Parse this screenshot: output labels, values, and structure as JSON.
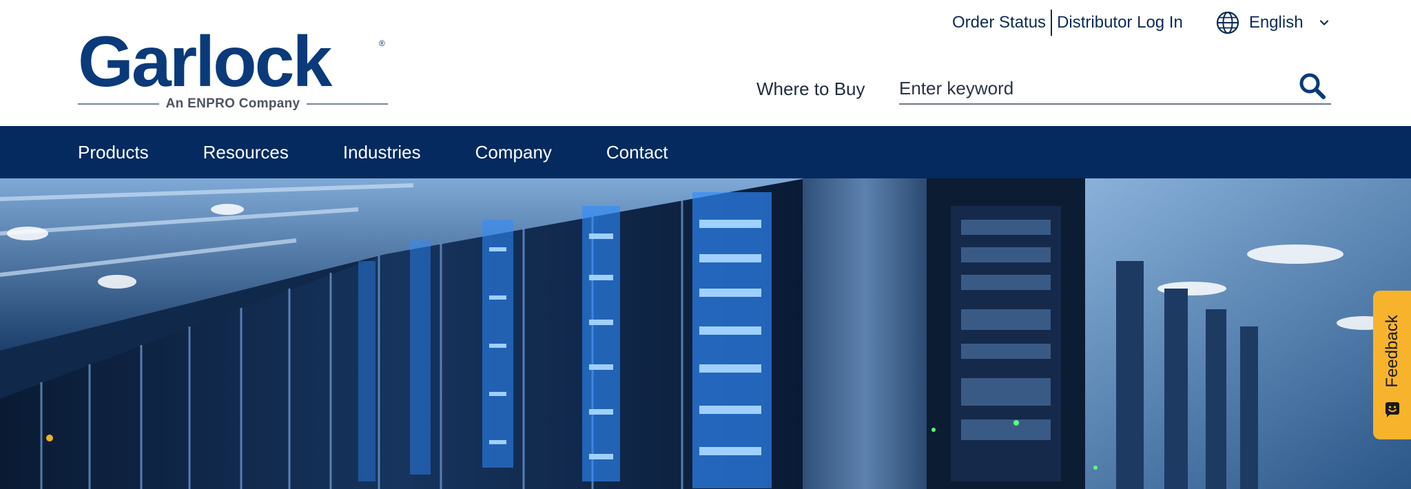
{
  "brand": {
    "name": "Garlock",
    "tagline": "An ENPRO Company",
    "primary_color": "#042a5f",
    "logo_color": "#0a3a7a"
  },
  "utility": {
    "order_status": "Order Status",
    "distributor_login": "Distributor Log In",
    "language": "English"
  },
  "header": {
    "where_to_buy": "Where to Buy",
    "search_placeholder": "Enter keyword",
    "search_value": ""
  },
  "nav": {
    "items": [
      {
        "label": "Products"
      },
      {
        "label": "Resources"
      },
      {
        "label": "Industries"
      },
      {
        "label": "Company"
      },
      {
        "label": "Contact"
      }
    ]
  },
  "hero": {
    "icon": "server-racks-photo"
  },
  "feedback": {
    "label": "Feedback",
    "color": "#f7b32b"
  }
}
